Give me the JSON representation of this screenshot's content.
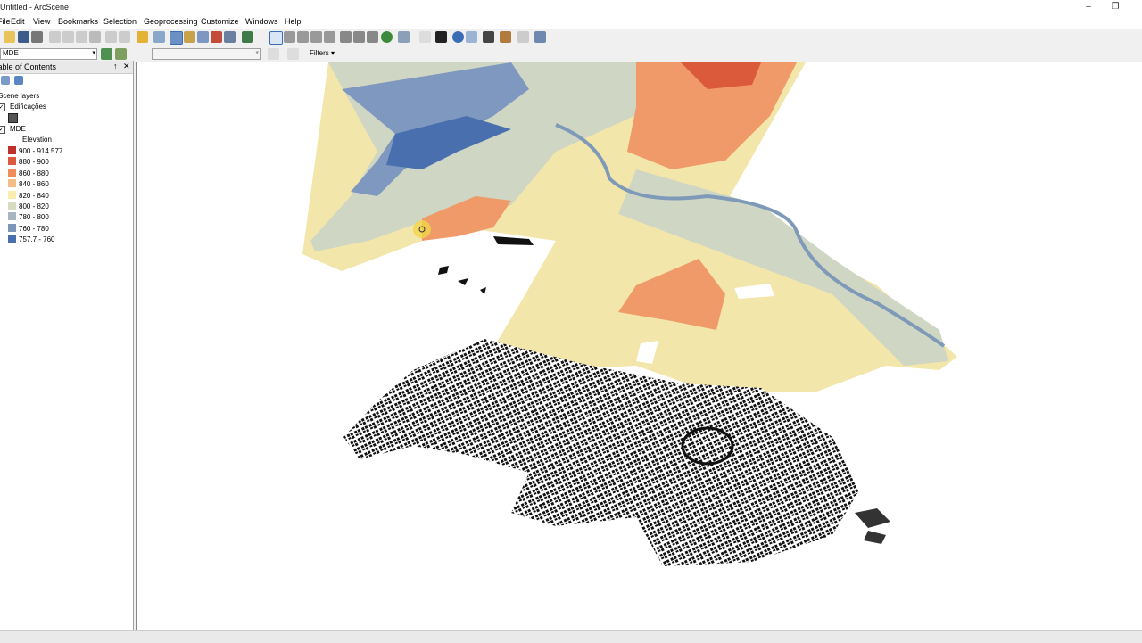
{
  "window": {
    "title": "Untitled - ArcScene"
  },
  "menu": [
    "File",
    "Edit",
    "View",
    "Bookmarks",
    "Selection",
    "Geoprocessing",
    "Customize",
    "Windows",
    "Help"
  ],
  "toolbar": {
    "layer_select": "MDE",
    "filters_label": "Filters",
    "layer_input": ""
  },
  "toc": {
    "title": "Table of Contents",
    "root": "Scene layers",
    "layers": [
      {
        "name": "Edificações",
        "checked": true,
        "symbol_color": "#555555"
      },
      {
        "name": "MDE",
        "checked": true,
        "legend_title": "Elevation"
      }
    ],
    "legend": [
      {
        "label": "900 - 914.577",
        "color": "#c0302a"
      },
      {
        "label": "880 - 900",
        "color": "#dc5a3c"
      },
      {
        "label": "860 - 880",
        "color": "#ef8c5a"
      },
      {
        "label": "840 - 860",
        "color": "#f5bd86"
      },
      {
        "label": "820 - 840",
        "color": "#f7eeb0"
      },
      {
        "label": "800 - 820",
        "color": "#d6dbc2"
      },
      {
        "label": "780 - 800",
        "color": "#a8b4c0"
      },
      {
        "label": "760 - 780",
        "color": "#7c95ba"
      },
      {
        "label": "757.7 - 760",
        "color": "#4a6fae"
      }
    ]
  },
  "scene": {
    "terrain_colors": {
      "high": "#dc5a3c",
      "mid_high": "#ef9a68",
      "mid": "#f3e6ab",
      "low_mid": "#cfd6c4",
      "low": "#7f98bf",
      "lowest": "#4a6fae",
      "river": "#7f9ab8"
    },
    "building_color": "#111111"
  }
}
